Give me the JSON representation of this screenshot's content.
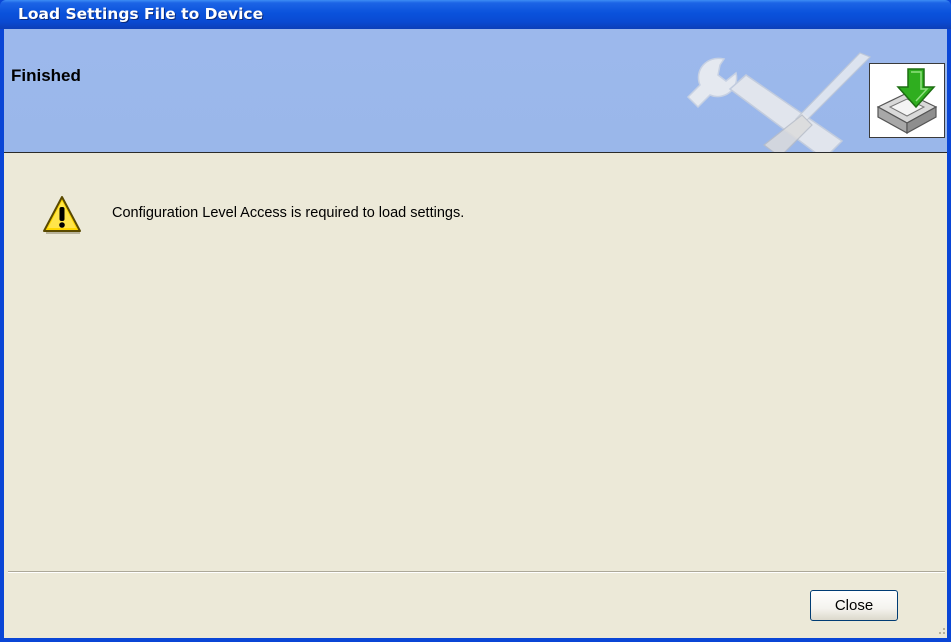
{
  "window": {
    "title": "Load Settings File to Device"
  },
  "header": {
    "title": "Finished",
    "decoration_icon": "wrench-screwdriver-icon",
    "badge_icon": "download-to-device-icon"
  },
  "message": {
    "icon": "warning-icon",
    "text": "Configuration Level Access is required to load settings."
  },
  "footer": {
    "close_label": "Close"
  },
  "colors": {
    "titlebar": "#0a4ad2",
    "header_bg": "#9cb8ec",
    "dialog_bg": "#ece9d8",
    "warning_fill": "#ffd700",
    "arrow_green": "#2fae1f"
  }
}
